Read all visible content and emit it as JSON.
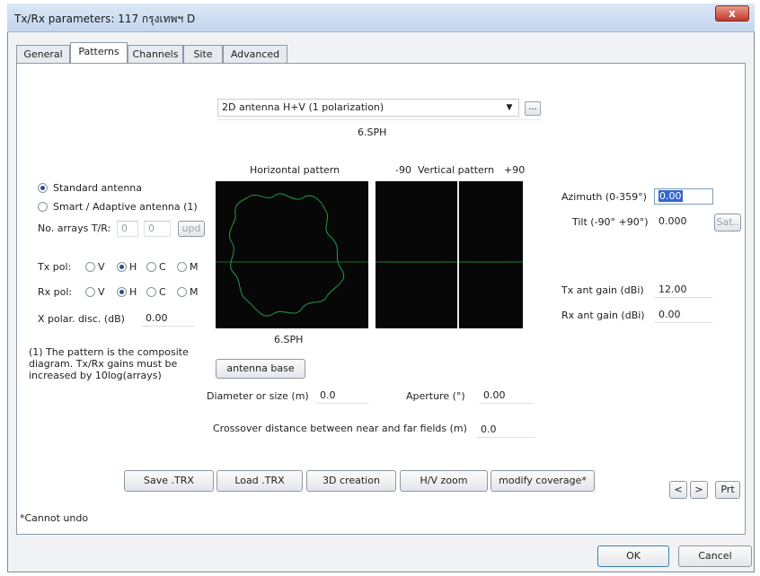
{
  "window": {
    "title": "Tx/Rx parameters: 117 กรุงเทพฯ D",
    "close_label": "x"
  },
  "tabs": [
    {
      "label": "General",
      "active": false
    },
    {
      "label": "Patterns",
      "active": true
    },
    {
      "label": "Channels",
      "active": false
    },
    {
      "label": "Site",
      "active": false
    },
    {
      "label": "Advanced",
      "active": false
    }
  ],
  "antenna_type": {
    "selected": "2D antenna H+V (1 polarization)",
    "browse_label": "...",
    "file": "6.SPH"
  },
  "plots": {
    "horizontal_title": "Horizontal pattern",
    "vertical_title": "Vertical pattern",
    "vertical_min": "-90",
    "vertical_max": "+90",
    "footer_file": "6.SPH"
  },
  "left": {
    "standard_antenna": "Standard antenna",
    "smart_antenna": "Smart / Adaptive antenna (1)",
    "no_arrays_label": "No. arrays T/R:",
    "arrays_t": "0",
    "arrays_r": "0",
    "upd_label": "upd",
    "tx_pol_label": "Tx pol:",
    "rx_pol_label": "Rx pol:",
    "pol_options": [
      "V",
      "H",
      "C",
      "M"
    ],
    "tx_pol_selected": "H",
    "rx_pol_selected": "H",
    "xpol_label": "X polar. disc. (dB)",
    "xpol_value": "0.00",
    "note": [
      "(1) The pattern is the composite",
      "diagram. Tx/Rx gains must be",
      "increased by 10log(arrays)"
    ]
  },
  "right": {
    "azimuth_label": "Azimuth (0-359°)",
    "azimuth_value": "0.00",
    "tilt_label": "Tilt (-90° +90°)",
    "tilt_value": "0.000",
    "sat_label": "Sat..",
    "tx_gain_label": "Tx ant gain (dBi)",
    "tx_gain_value": "12.00",
    "rx_gain_label": "Rx ant gain (dBi)",
    "rx_gain_value": "0.00"
  },
  "bottom": {
    "antenna_base_label": "antenna base",
    "diameter_label": "Diameter or size (m)",
    "diameter_value": "0.0",
    "aperture_label": "Aperture (°)",
    "aperture_value": "0.00",
    "crossover_label": "Crossover distance between near and far fields (m)",
    "crossover_value": "0.0"
  },
  "actions": {
    "save": "Save .TRX",
    "load": "Load .TRX",
    "creation3d": "3D creation",
    "hv_zoom": "H/V zoom",
    "modify": "modify coverage*",
    "prev": "<",
    "next": ">",
    "prt": "Prt"
  },
  "footer": {
    "note": "*Cannot undo",
    "ok": "OK",
    "cancel": "Cancel"
  },
  "colors": {
    "pattern_line": "#1f9a4a",
    "selection": "#3366cc"
  }
}
